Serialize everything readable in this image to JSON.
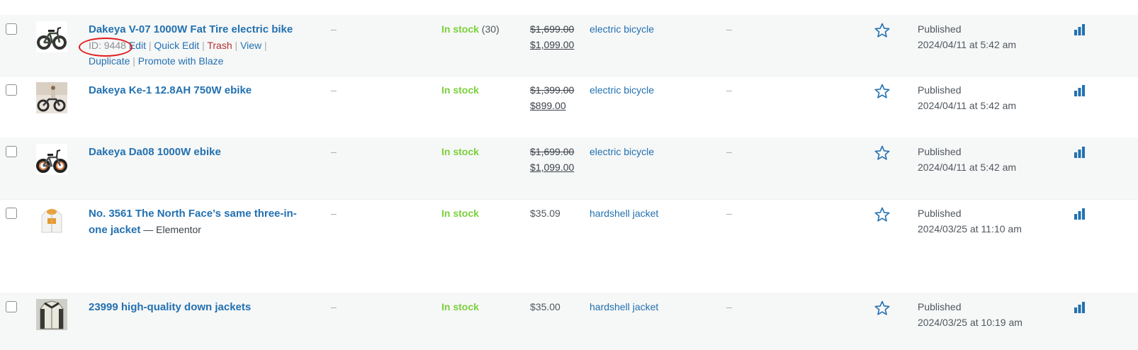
{
  "rows": [
    {
      "title": "Dakeya V-07 1000W Fat Tire electric bike",
      "title_suffix": "",
      "thumb": "bike-black-icon",
      "actions": {
        "id": "ID: 9448",
        "edit": "Edit",
        "quick_edit": "Quick Edit",
        "trash": "Trash",
        "view": "View",
        "duplicate": "Duplicate",
        "promote": "Promote with Blaze",
        "sep": "|"
      },
      "sku": "–",
      "stock": "In stock",
      "stock_qty": "(30)",
      "price_regular": "$1,699.00",
      "price_sale": "$1,099.00",
      "category": "electric bicycle",
      "tags": "–",
      "date_status": "Published",
      "date_value": "2024/04/11 at 5:42 am"
    },
    {
      "title": "Dakeya Ke-1 12.8AH 750W ebike",
      "title_suffix": "",
      "thumb": "bike-rider-icon",
      "sku": "–",
      "stock": "In stock",
      "stock_qty": "",
      "price_regular": "$1,399.00",
      "price_sale": "$899.00",
      "category": "electric bicycle",
      "tags": "–",
      "date_status": "Published",
      "date_value": "2024/04/11 at 5:42 am"
    },
    {
      "title": "Dakeya Da08 1000W ebike",
      "title_suffix": "",
      "thumb": "bike-orange-icon",
      "sku": "–",
      "stock": "In stock",
      "stock_qty": "",
      "price_regular": "$1,699.00",
      "price_sale": "$1,099.00",
      "category": "electric bicycle",
      "tags": "–",
      "date_status": "Published",
      "date_value": "2024/04/11 at 5:42 am"
    },
    {
      "title": "No. 3561 The North Face’s same three-in-one jacket",
      "title_suffix": " — Elementor",
      "thumb": "jacket-white-icon",
      "sku": "–",
      "stock": "In stock",
      "stock_qty": "",
      "price": "$35.09",
      "category": "hardshell jacket",
      "tags": "–",
      "date_status": "Published",
      "date_value": "2024/03/25 at 11:10 am"
    },
    {
      "title": "23999 high-quality down jackets",
      "title_suffix": "",
      "thumb": "jacket-grey-icon",
      "sku": "–",
      "stock": "In stock",
      "stock_qty": "",
      "price": "$35.00",
      "category": "hardshell jacket",
      "tags": "–",
      "date_status": "Published",
      "date_value": "2024/03/25 at 10:19 am"
    }
  ],
  "colors": {
    "link": "#2271b1",
    "in_stock": "#7ad03a",
    "trash": "#b32d2e",
    "highlight_oval": "#e01b1b"
  }
}
